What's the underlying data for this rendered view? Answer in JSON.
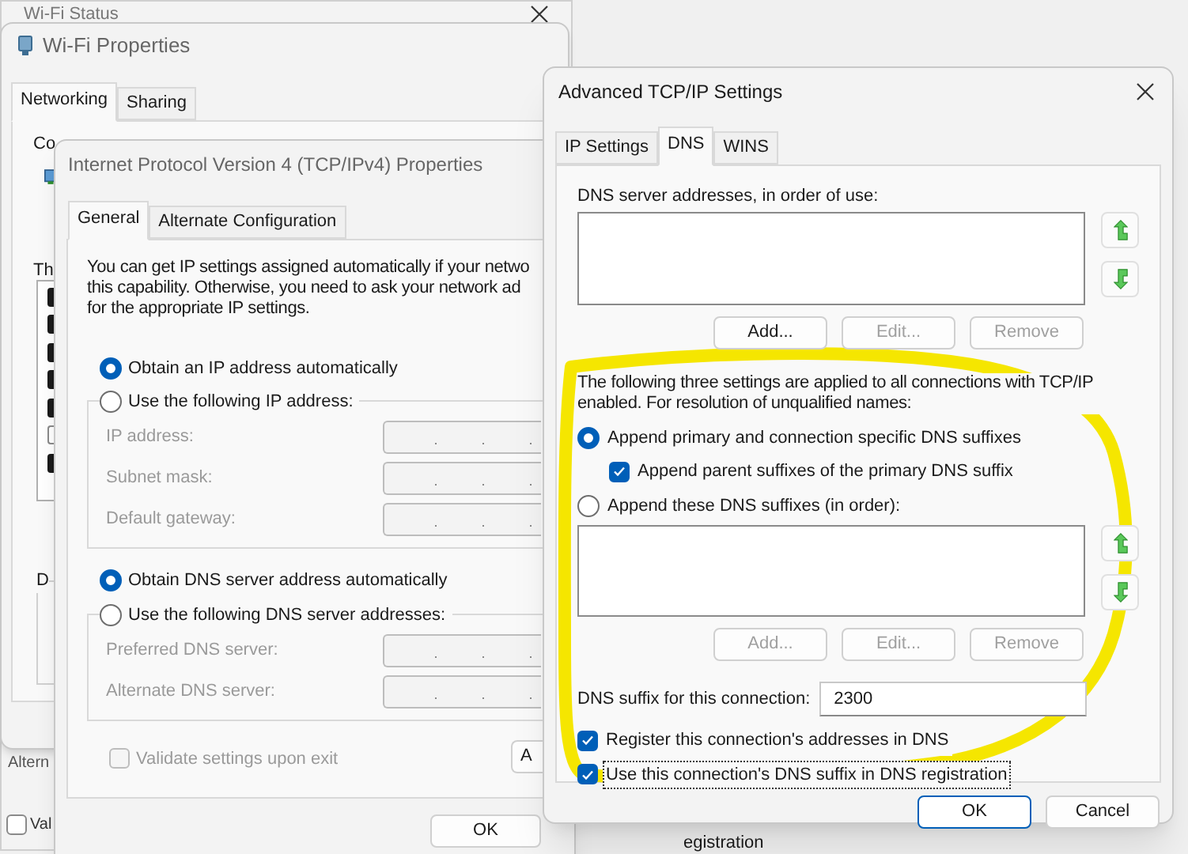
{
  "wifi_status": {
    "title": "Wi-Fi Status",
    "alternate_fragment": "Altern",
    "validate": {
      "label": "Val",
      "checked": false
    }
  },
  "wifi_properties": {
    "title": "Wi-Fi Properties",
    "tabs": [
      {
        "label": "Networking",
        "selected": true
      },
      {
        "label": "Sharing",
        "selected": false
      }
    ],
    "connect_fragment": "Co",
    "list_fragment": "Th",
    "group_fragment": "D",
    "components": [
      {
        "checked": true
      },
      {
        "checked": true
      },
      {
        "checked": true
      },
      {
        "checked": true
      },
      {
        "checked": true
      },
      {
        "checked": false
      },
      {
        "checked": true
      }
    ]
  },
  "ipv4": {
    "title": "Internet Protocol Version 4 (TCP/IPv4) Properties",
    "tabs": [
      {
        "label": "General",
        "selected": true
      },
      {
        "label": "Alternate Configuration",
        "selected": false
      }
    ],
    "intro": [
      "You can get IP settings assigned automatically if your netwo",
      "this capability. Otherwise, you need to ask your network ad",
      "for the appropriate IP settings."
    ],
    "ip_modes": [
      {
        "label": "Obtain an IP address automatically",
        "selected": true
      },
      {
        "label": "Use the following IP address:",
        "selected": false
      }
    ],
    "ip_fields": [
      {
        "label": "IP address:",
        "disabled": true
      },
      {
        "label": "Subnet mask:",
        "disabled": true
      },
      {
        "label": "Default gateway:",
        "disabled": true
      }
    ],
    "dns_modes": [
      {
        "label": "Obtain DNS server address automatically",
        "selected": true
      },
      {
        "label": "Use the following DNS server addresses:",
        "selected": false
      }
    ],
    "dns_fields": [
      {
        "label": "Preferred DNS server:",
        "disabled": true
      },
      {
        "label": "Alternate DNS server:",
        "disabled": true
      }
    ],
    "validate": {
      "label": "Validate settings upon exit",
      "checked": false,
      "disabled": true
    },
    "advanced_button": "A",
    "ok_button": "OK"
  },
  "advanced": {
    "title": "Advanced TCP/IP Settings",
    "tabs": [
      {
        "label": "IP Settings",
        "selected": false
      },
      {
        "label": "DNS",
        "selected": true
      },
      {
        "label": "WINS",
        "selected": false
      }
    ],
    "servers_label": "DNS server addresses, in order of use:",
    "server_buttons": [
      {
        "label": "Add...",
        "disabled": false
      },
      {
        "label": "Edit...",
        "disabled": true
      },
      {
        "label": "Remove",
        "disabled": true
      }
    ],
    "note": "The following three settings are applied to all connections with TCP/IP enabled. For resolution of unqualified names:",
    "suffix_modes": [
      {
        "label": "Append primary and connection specific DNS suffixes",
        "selected": true
      },
      {
        "label": "Append these DNS suffixes (in order):",
        "selected": false
      }
    ],
    "parent_suffixes": {
      "label": "Append parent suffixes of the primary DNS suffix",
      "checked": true
    },
    "suffix_buttons": [
      {
        "label": "Add...",
        "disabled": true
      },
      {
        "label": "Edit...",
        "disabled": true
      },
      {
        "label": "Remove",
        "disabled": true
      }
    ],
    "suffix_label": "DNS suffix for this connection:",
    "suffix_value": "2300",
    "register_options": [
      {
        "label": "Register this connection's addresses in DNS",
        "checked": true,
        "focused": false
      },
      {
        "label": "Use this connection's DNS suffix in DNS registration",
        "checked": true,
        "focused": true
      }
    ],
    "ok_button": "OK",
    "cancel_button": "Cancel"
  },
  "background_fragment": "egistration"
}
